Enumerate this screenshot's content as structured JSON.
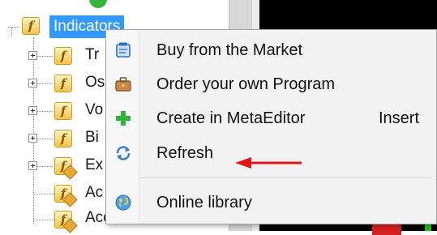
{
  "navigator": {
    "root": {
      "label": "Indicators",
      "icon": "fx-folder-icon"
    },
    "children": [
      {
        "label": "Tr",
        "icon": "fx-folder-icon",
        "expandable": true
      },
      {
        "label": "Os",
        "icon": "fx-folder-icon",
        "expandable": true
      },
      {
        "label": "Vo",
        "icon": "fx-folder-icon",
        "expandable": true
      },
      {
        "label": "Bi",
        "icon": "fx-folder-icon",
        "expandable": true
      },
      {
        "label": "Ex",
        "icon": "fx-indicator-icon",
        "expandable": true
      },
      {
        "label": "Ac",
        "icon": "fx-indicator-icon",
        "expandable": false
      },
      {
        "label": "Accumulation",
        "icon": "fx-indicator-icon",
        "expandable": false
      }
    ]
  },
  "context_menu": {
    "items": [
      {
        "label": "Buy from the Market",
        "icon": "market-icon",
        "shortcut": ""
      },
      {
        "label": "Order your own Program",
        "icon": "briefcase-icon",
        "shortcut": ""
      },
      {
        "label": "Create in MetaEditor",
        "icon": "green-plus-icon",
        "shortcut": "Insert"
      },
      {
        "label": "Refresh",
        "icon": "refresh-icon",
        "shortcut": ""
      },
      {
        "label": "Online library",
        "icon": "globe-icon",
        "shortcut": ""
      }
    ]
  },
  "colors": {
    "selection": "#3399ff",
    "menu_background": "#f2f2f2",
    "arrow": "#e01616",
    "chart_background": "#000000"
  }
}
